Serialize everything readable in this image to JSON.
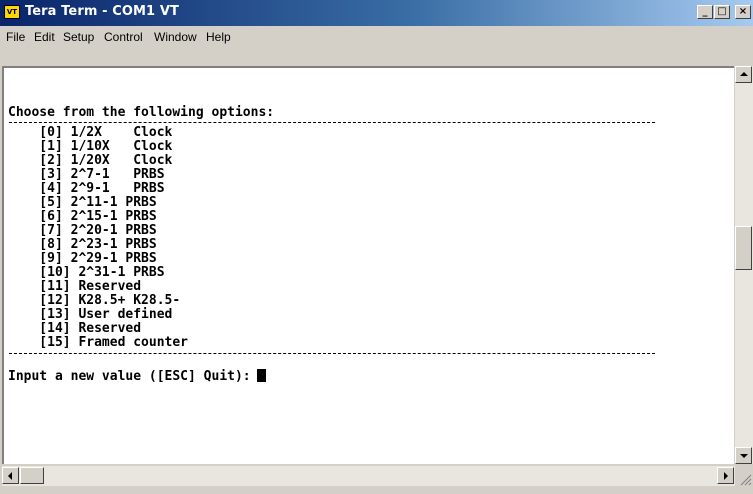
{
  "window": {
    "title": "Tera Term - COM1 VT",
    "icon_label": "VT",
    "minimize_glyph": "_",
    "maximize_glyph": "□",
    "close_glyph": "×"
  },
  "menu": {
    "items": [
      "File",
      "Edit",
      "Setup",
      "Control",
      "Window",
      "Help"
    ]
  },
  "terminal": {
    "header": "Choose from the following options:",
    "options": [
      "    [0] 1/2X    Clock",
      "    [1] 1/10X   Clock",
      "    [2] 1/20X   Clock",
      "    [3] 2^7-1   PRBS",
      "    [4] 2^9-1   PRBS",
      "    [5] 2^11-1 PRBS",
      "    [6] 2^15-1 PRBS",
      "    [7] 2^20-1 PRBS",
      "    [8] 2^23-1 PRBS",
      "    [9] 2^29-1 PRBS",
      "    [10] 2^31-1 PRBS",
      "    [11] Reserved",
      "    [12] K28.5+ K28.5-",
      "    [13] User defined",
      "    [14] Reserved",
      "    [15] Framed counter"
    ],
    "prompt": "Input a new value ([ESC] Quit):"
  },
  "colors": {
    "title_start": "#0a246a",
    "title_end": "#a6caf0",
    "chrome": "#d4d0c8",
    "terminal_bg": "#ffffff",
    "terminal_fg": "#000000"
  }
}
